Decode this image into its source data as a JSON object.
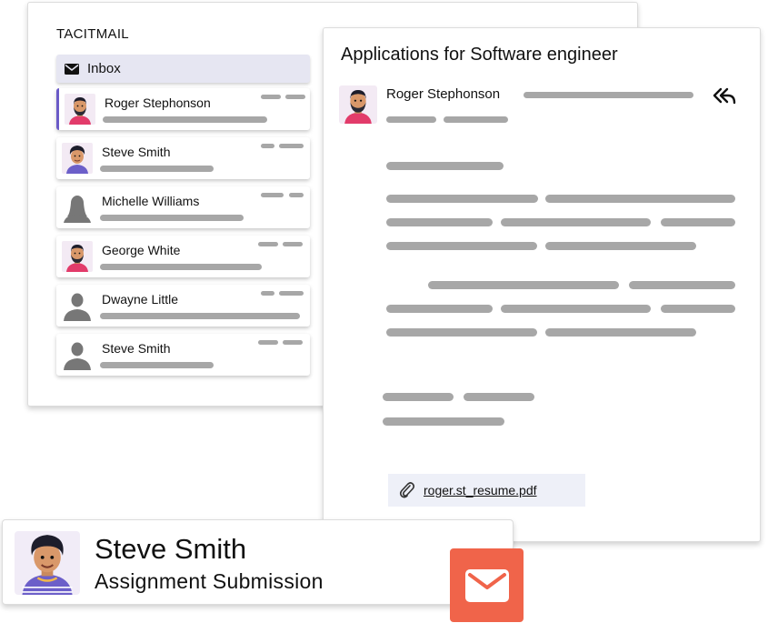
{
  "app": {
    "brand": "TACITMAIL"
  },
  "sidebar": {
    "inbox_label": "Inbox",
    "items": [
      {
        "name": "Roger Stephonson",
        "avatar": "man-beard-avatar",
        "active": true
      },
      {
        "name": "Steve Smith",
        "avatar": "man-curly-avatar",
        "active": false
      },
      {
        "name": "Michelle Williams",
        "avatar": "person-silhouette-icon",
        "active": false
      },
      {
        "name": "George White",
        "avatar": "man-beard-avatar",
        "active": false
      },
      {
        "name": "Dwayne Little",
        "avatar": "person-silhouette-icon",
        "active": false
      },
      {
        "name": "Steve Smith",
        "avatar": "person-silhouette-icon",
        "active": false
      }
    ]
  },
  "message": {
    "subject": "Applications for Software engineer",
    "sender": "Roger Stephonson",
    "attachment": "roger.st_resume.pdf"
  },
  "notification": {
    "name": "Steve Smith",
    "subject": "Assignment Submission"
  },
  "colors": {
    "accent": "#6a5ac7",
    "inbox_bg": "#e6e6f2",
    "placeholder_bar": "#a7a7a7",
    "mail_badge": "#f0644a",
    "attachment_bg": "#eef0f8"
  }
}
